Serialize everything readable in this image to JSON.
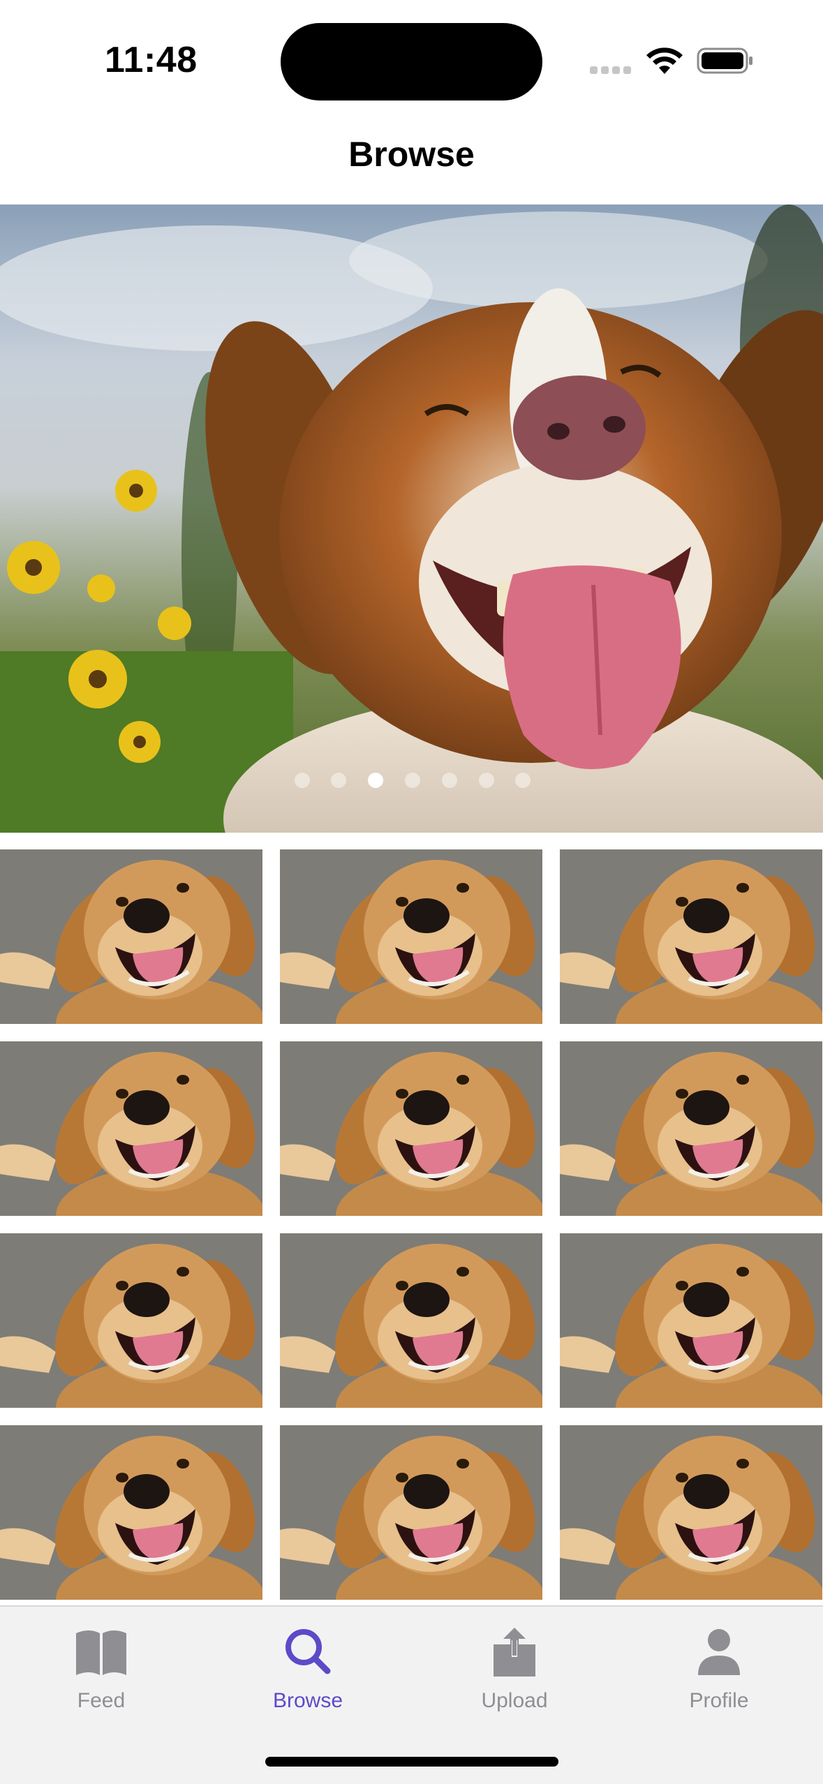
{
  "status_bar": {
    "time": "11:48"
  },
  "nav": {
    "title": "Browse"
  },
  "carousel": {
    "page_count": 7,
    "current_page": 3
  },
  "grid": {
    "columns": 3,
    "rows": 4
  },
  "tab_bar": {
    "tabs": [
      {
        "label": "Feed",
        "icon": "book-icon",
        "active": false
      },
      {
        "label": "Browse",
        "icon": "search-icon",
        "active": true
      },
      {
        "label": "Upload",
        "icon": "upload-icon",
        "active": false
      },
      {
        "label": "Profile",
        "icon": "person-icon",
        "active": false
      }
    ]
  },
  "colors": {
    "accent": "#5b4bc9",
    "inactive": "#8e8e93",
    "tab_bar_bg": "#f3f2f3"
  }
}
